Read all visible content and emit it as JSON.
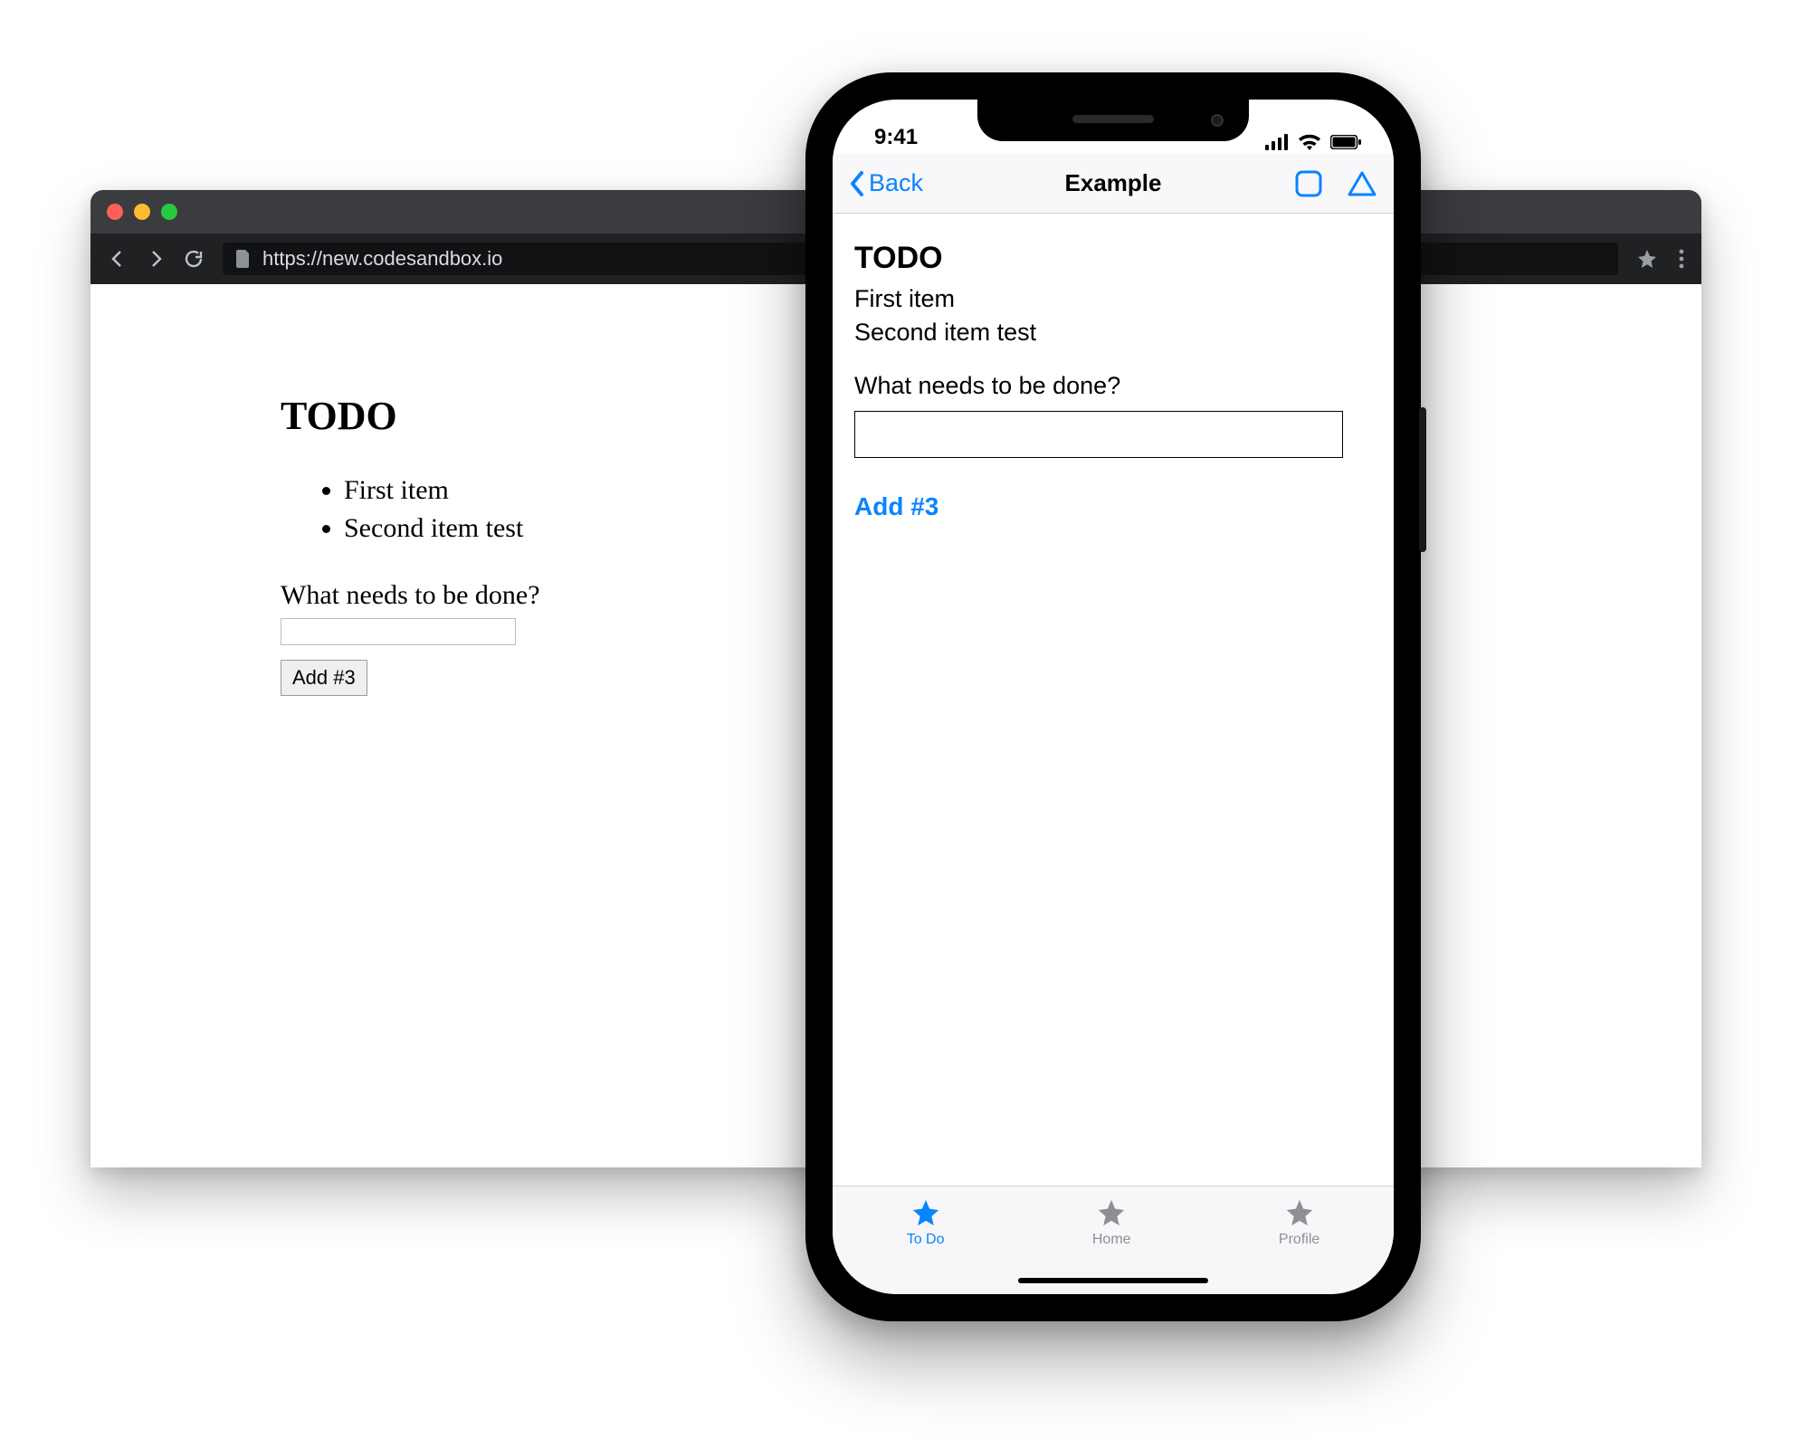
{
  "browser": {
    "url": "https://new.codesandbox.io",
    "page": {
      "heading": "TODO",
      "items": [
        "First item",
        "Second item test"
      ],
      "prompt": "What needs to be done?",
      "input_value": "",
      "add_button": "Add #3"
    }
  },
  "phone": {
    "status": {
      "time": "9:41"
    },
    "navbar": {
      "back_label": "Back",
      "title": "Example"
    },
    "content": {
      "heading": "TODO",
      "items": [
        "First item",
        "Second item test"
      ],
      "prompt": "What needs to be done?",
      "input_value": "",
      "add_link": "Add #3"
    },
    "tabs": [
      {
        "label": "To Do",
        "active": true
      },
      {
        "label": "Home",
        "active": false
      },
      {
        "label": "Profile",
        "active": false
      }
    ]
  }
}
